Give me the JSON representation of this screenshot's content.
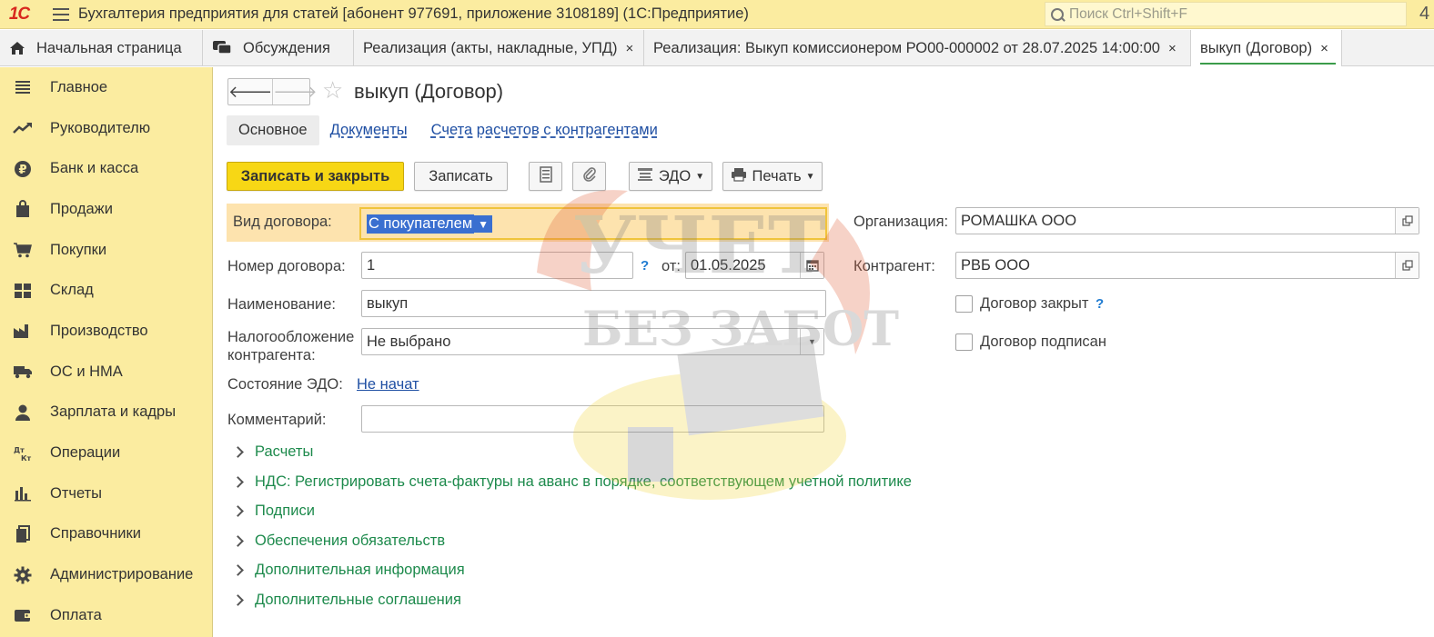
{
  "titlebar": {
    "logo": "1С",
    "title": "Бухгалтерия предприятия для статей [абонент 977691, приложение 3108189]  (1С:Предприятие)",
    "search_placeholder": "Поиск Ctrl+Shift+F",
    "corner": "4"
  },
  "tabs": [
    {
      "label": "Начальная страница",
      "icon": "home-icon"
    },
    {
      "label": "Обсуждения",
      "icon": "chat-icon"
    },
    {
      "label": "Реализация (акты, накладные, УПД)",
      "close": "×"
    },
    {
      "label": "Реализация: Выкуп комиссионером РО00-000002 от 28.07.2025 14:00:00",
      "close": "×"
    },
    {
      "label": "выкуп (Договор)",
      "close": "×",
      "active": true
    }
  ],
  "sidebar": {
    "items": [
      {
        "label": "Главное",
        "icon": "list-icon"
      },
      {
        "label": "Руководителю",
        "icon": "trend-icon"
      },
      {
        "label": "Банк и касса",
        "icon": "ruble-icon"
      },
      {
        "label": "Продажи",
        "icon": "bag-icon"
      },
      {
        "label": "Покупки",
        "icon": "cart-icon"
      },
      {
        "label": "Склад",
        "icon": "warehouse-icon"
      },
      {
        "label": "Производство",
        "icon": "factory-icon"
      },
      {
        "label": "ОС и НМА",
        "icon": "truck-icon"
      },
      {
        "label": "Зарплата и кадры",
        "icon": "person-icon"
      },
      {
        "label": "Операции",
        "icon": "dtkt-icon"
      },
      {
        "label": "Отчеты",
        "icon": "barchart-icon"
      },
      {
        "label": "Справочники",
        "icon": "books-icon"
      },
      {
        "label": "Администрирование",
        "icon": "gear-icon"
      },
      {
        "label": "Оплата",
        "icon": "wallet-icon"
      }
    ]
  },
  "form": {
    "title": "выкуп (Договор)",
    "subtabs": {
      "main": "Основное",
      "docs": "Документы",
      "accounts": "Счета расчетов с контрагентами"
    },
    "toolbar": {
      "save_close": "Записать и закрыть",
      "save": "Записать",
      "edo": "ЭДО",
      "print": "Печать"
    },
    "fields": {
      "contract_type_label": "Вид договора:",
      "contract_type_value": "С покупателем",
      "number_label": "Номер договора:",
      "number_value": "1",
      "help": "?",
      "date_label": "от:",
      "date_value": "01.05.2025",
      "name_label": "Наименование:",
      "name_value": "выкуп",
      "tax_label_1": "Налогообложение",
      "tax_label_2": "контрагента:",
      "tax_value": "Не выбрано",
      "edo_label": "Состояние ЭДО:",
      "edo_value": "Не начат",
      "comment_label": "Комментарий:",
      "comment_value": "",
      "org_label": "Организация:",
      "org_value": "РОМАШКА ООО",
      "counterparty_label": "Контрагент:",
      "counterparty_value": "РВБ ООО",
      "closed_label": "Договор закрыт",
      "signed_label": "Договор подписан"
    },
    "groups": [
      "Расчеты",
      "НДС: Регистрировать счета-фактуры на аванс в порядке, соответствующем учетной политике",
      "Подписи",
      "Обеспечения обязательств",
      "Дополнительная информация",
      "Дополнительные соглашения"
    ]
  },
  "watermark": {
    "line1": "УЧЕТ",
    "line2": "БЕЗ ЗАБОТ"
  }
}
